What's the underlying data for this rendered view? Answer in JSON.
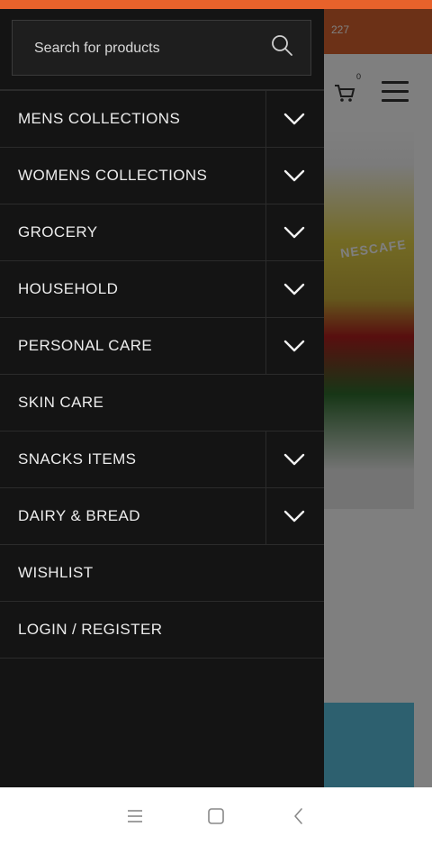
{
  "status_bar": {
    "color": "#e8622b"
  },
  "page": {
    "topbar_text": "227",
    "cart_count": "0",
    "banner_brand": "NESCAFE"
  },
  "drawer": {
    "search": {
      "placeholder": "Search for products",
      "icon": "search-icon"
    },
    "items": [
      {
        "label": "MENS COLLECTIONS",
        "has_submenu": true
      },
      {
        "label": "WOMENS COLLECTIONS",
        "has_submenu": true
      },
      {
        "label": "GROCERY",
        "has_submenu": true
      },
      {
        "label": "HOUSEHOLD",
        "has_submenu": true
      },
      {
        "label": "PERSONAL CARE",
        "has_submenu": true
      },
      {
        "label": "SKIN CARE",
        "has_submenu": false
      },
      {
        "label": "SNACKS ITEMS",
        "has_submenu": true
      },
      {
        "label": "DAIRY & BREAD",
        "has_submenu": true
      },
      {
        "label": "WISHLIST",
        "has_submenu": false
      },
      {
        "label": "LOGIN / REGISTER",
        "has_submenu": false
      }
    ]
  },
  "nav_bar": {
    "icons": [
      "menu-icon",
      "home-icon",
      "back-icon"
    ]
  }
}
